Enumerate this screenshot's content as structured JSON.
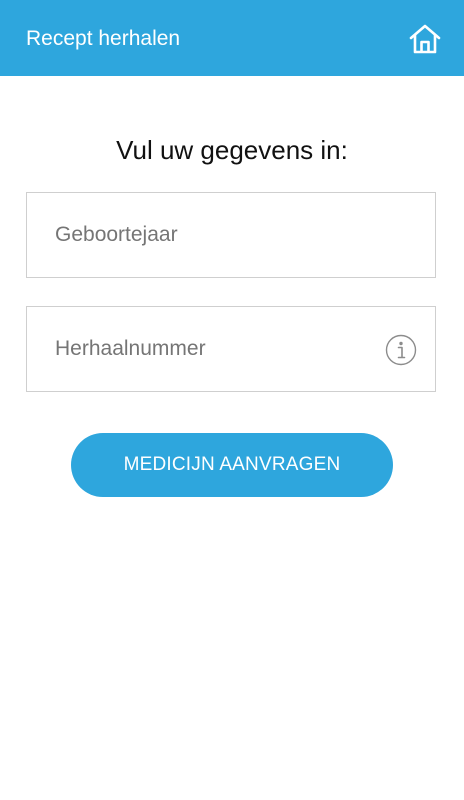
{
  "header": {
    "title": "Recept herhalen",
    "home_icon": "home-icon",
    "background_color": "#2ea6dd"
  },
  "form": {
    "prompt": "Vul uw gegevens in:",
    "birthyear": {
      "placeholder": "Geboortejaar",
      "value": ""
    },
    "repeat_number": {
      "placeholder": "Herhaalnummer",
      "value": "",
      "info_icon": "info-icon"
    },
    "submit_label": "MEDICIJN AANVRAGEN",
    "accent_color": "#2ea6dd"
  }
}
